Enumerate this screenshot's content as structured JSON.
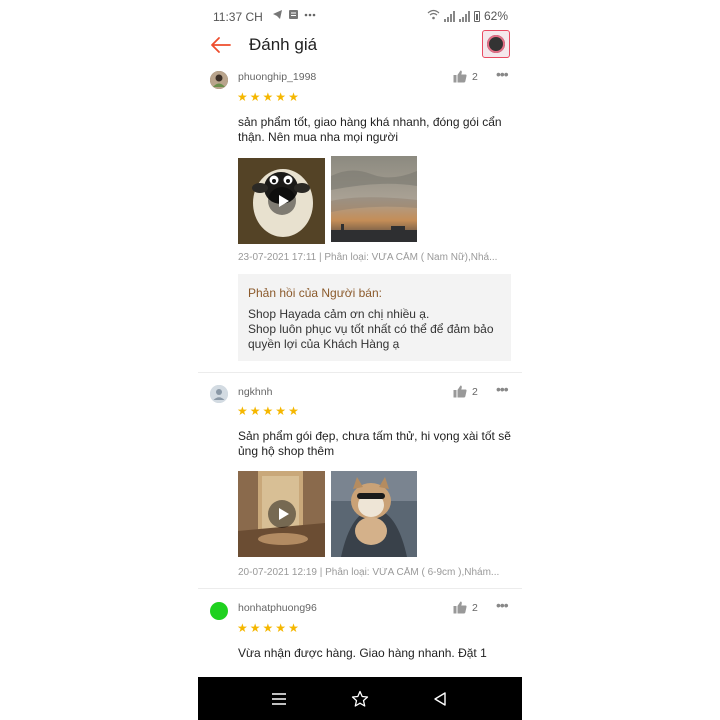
{
  "status_bar": {
    "time": "11:37 CH",
    "battery": "62%"
  },
  "header": {
    "title": "Đánh giá"
  },
  "reviews": [
    {
      "username": "phuonghip_1998",
      "likes": "2",
      "rating": 5,
      "text": "sản phẩm tốt, giao hàng khá nhanh, đóng gói cẩn thận. Nên mua nha mọi người",
      "meta": "23-07-2021 17:11 | Phân loại: VỪA  CẰM ( Nam Nữ),Nhá...",
      "avatar_color": "#6b5a4a",
      "reply": {
        "title": "Phản hồi của Người bán:",
        "body": "Shop Hayada cảm ơn chị nhiều ạ.\nShop luôn phục vụ tốt nhất có thể để đảm bảo quyền lợi của Khách Hàng ạ"
      }
    },
    {
      "username": "ngkhnh",
      "likes": "2",
      "rating": 5,
      "text": "Sản phẩm gói đẹp, chưa tấm thử, hi vọng xài tốt sẽ ủng hộ shop thêm",
      "meta": "20-07-2021 12:19 | Phân loại: VỪA  CẰM ( 6-9cm ),Nhám...",
      "avatar_color": "#c9d3dc"
    },
    {
      "username": "honhatphuong96",
      "likes": "2",
      "rating": 5,
      "text": "Vừa nhận được hàng. Giao hàng nhanh. Đặt 1",
      "avatar_color": "#1fd11f"
    }
  ],
  "colors": {
    "accent": "#ee4d2d",
    "star": "#f5b700",
    "reply_title": "#8b5a2b"
  },
  "icons": [
    "back-arrow-icon",
    "thumbs-up-icon",
    "more-icon",
    "play-icon",
    "menu-icon",
    "star-outline-icon",
    "back-triangle-icon"
  ]
}
